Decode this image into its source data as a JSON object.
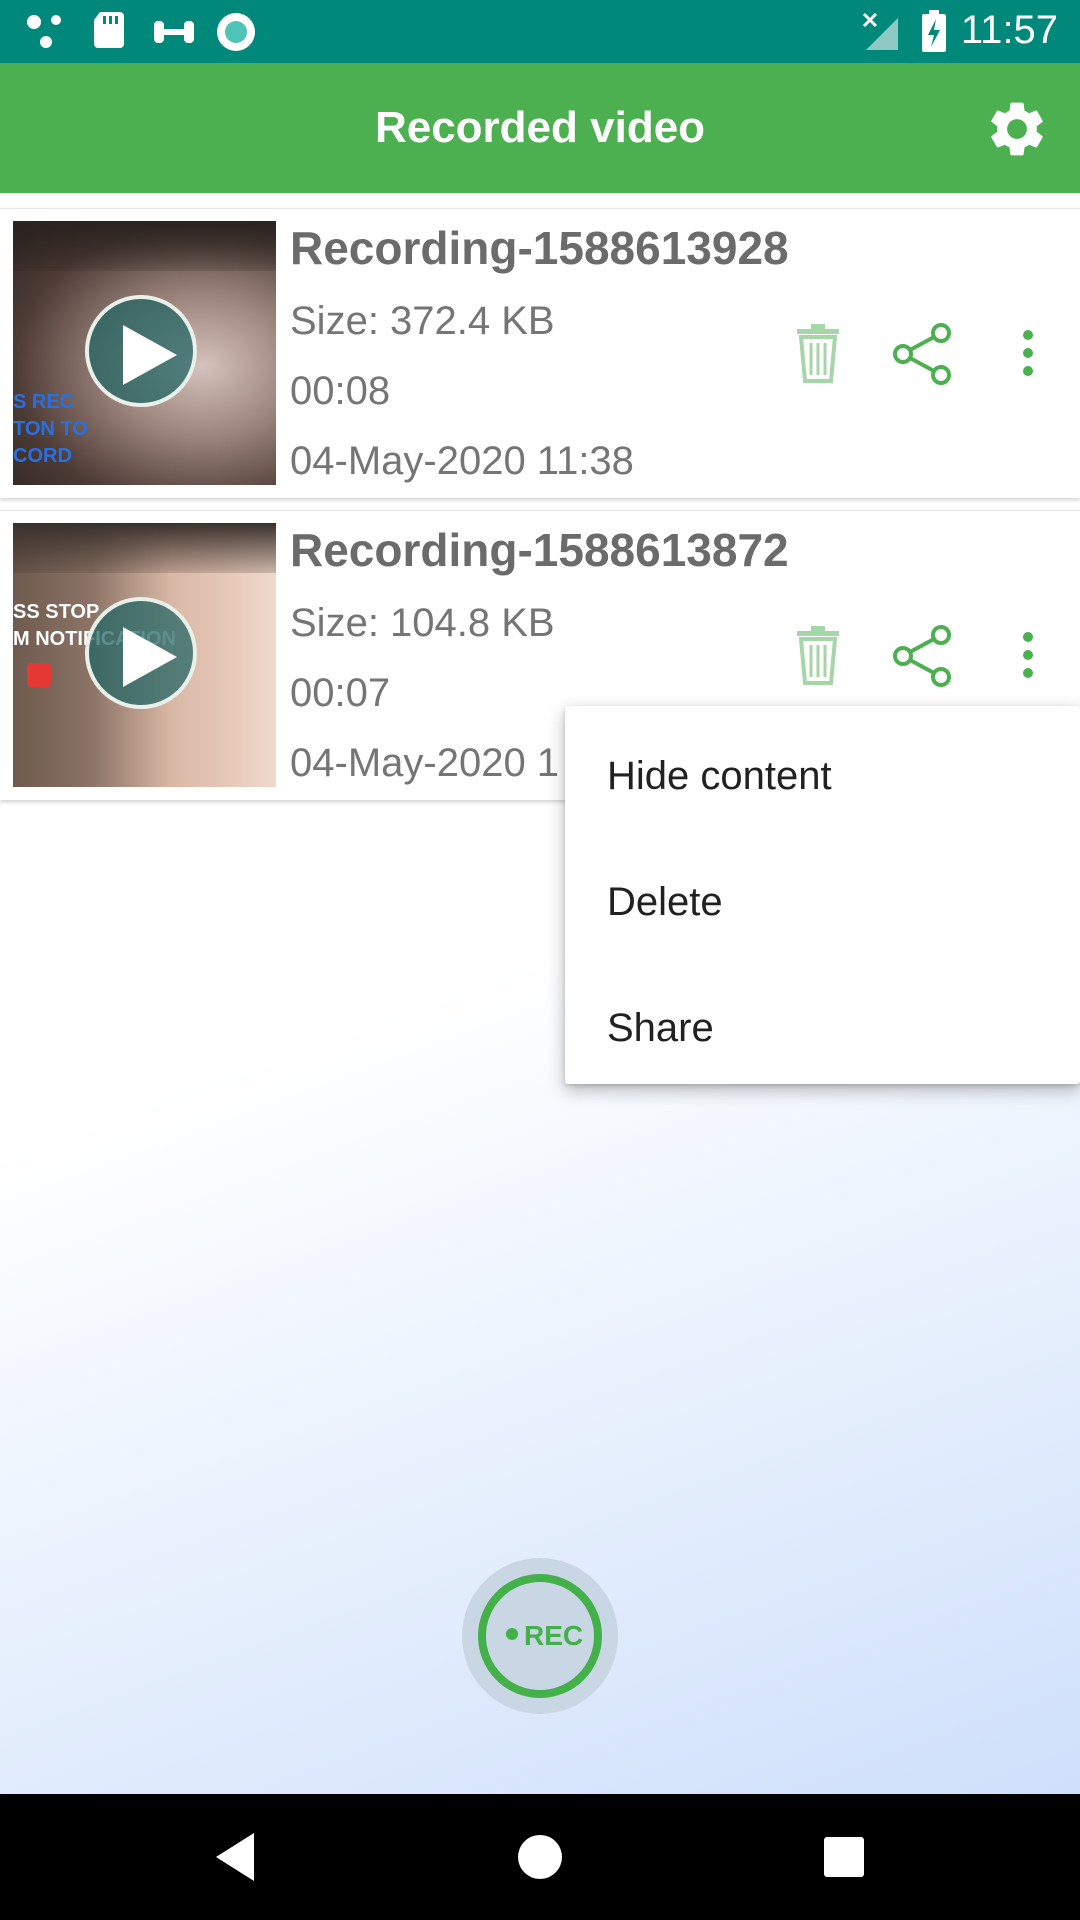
{
  "status_bar": {
    "time": "11:57",
    "icons": [
      "share-dots-icon",
      "sd-card-icon",
      "dumbbell-icon",
      "record-circle-icon",
      "no-signal-icon",
      "battery-charging-icon"
    ]
  },
  "app_bar": {
    "title": "Recorded video",
    "settings_icon": "gear-icon"
  },
  "recordings": [
    {
      "name": "Recording-1588613928",
      "size": "Size: 372.4 KB",
      "duration": "00:08",
      "date": "04-May-2020 11:38"
    },
    {
      "name": "Recording-1588613872",
      "size": "Size: 104.8 KB",
      "duration": "00:07",
      "date": "04-May-2020 1"
    }
  ],
  "menu": {
    "items": [
      "Hide content",
      "Delete",
      "Share"
    ]
  },
  "rec_button": {
    "label": "REC"
  },
  "colors": {
    "status_bar": "#00897b",
    "app_bar": "#4caf50",
    "accent": "#43b049"
  }
}
